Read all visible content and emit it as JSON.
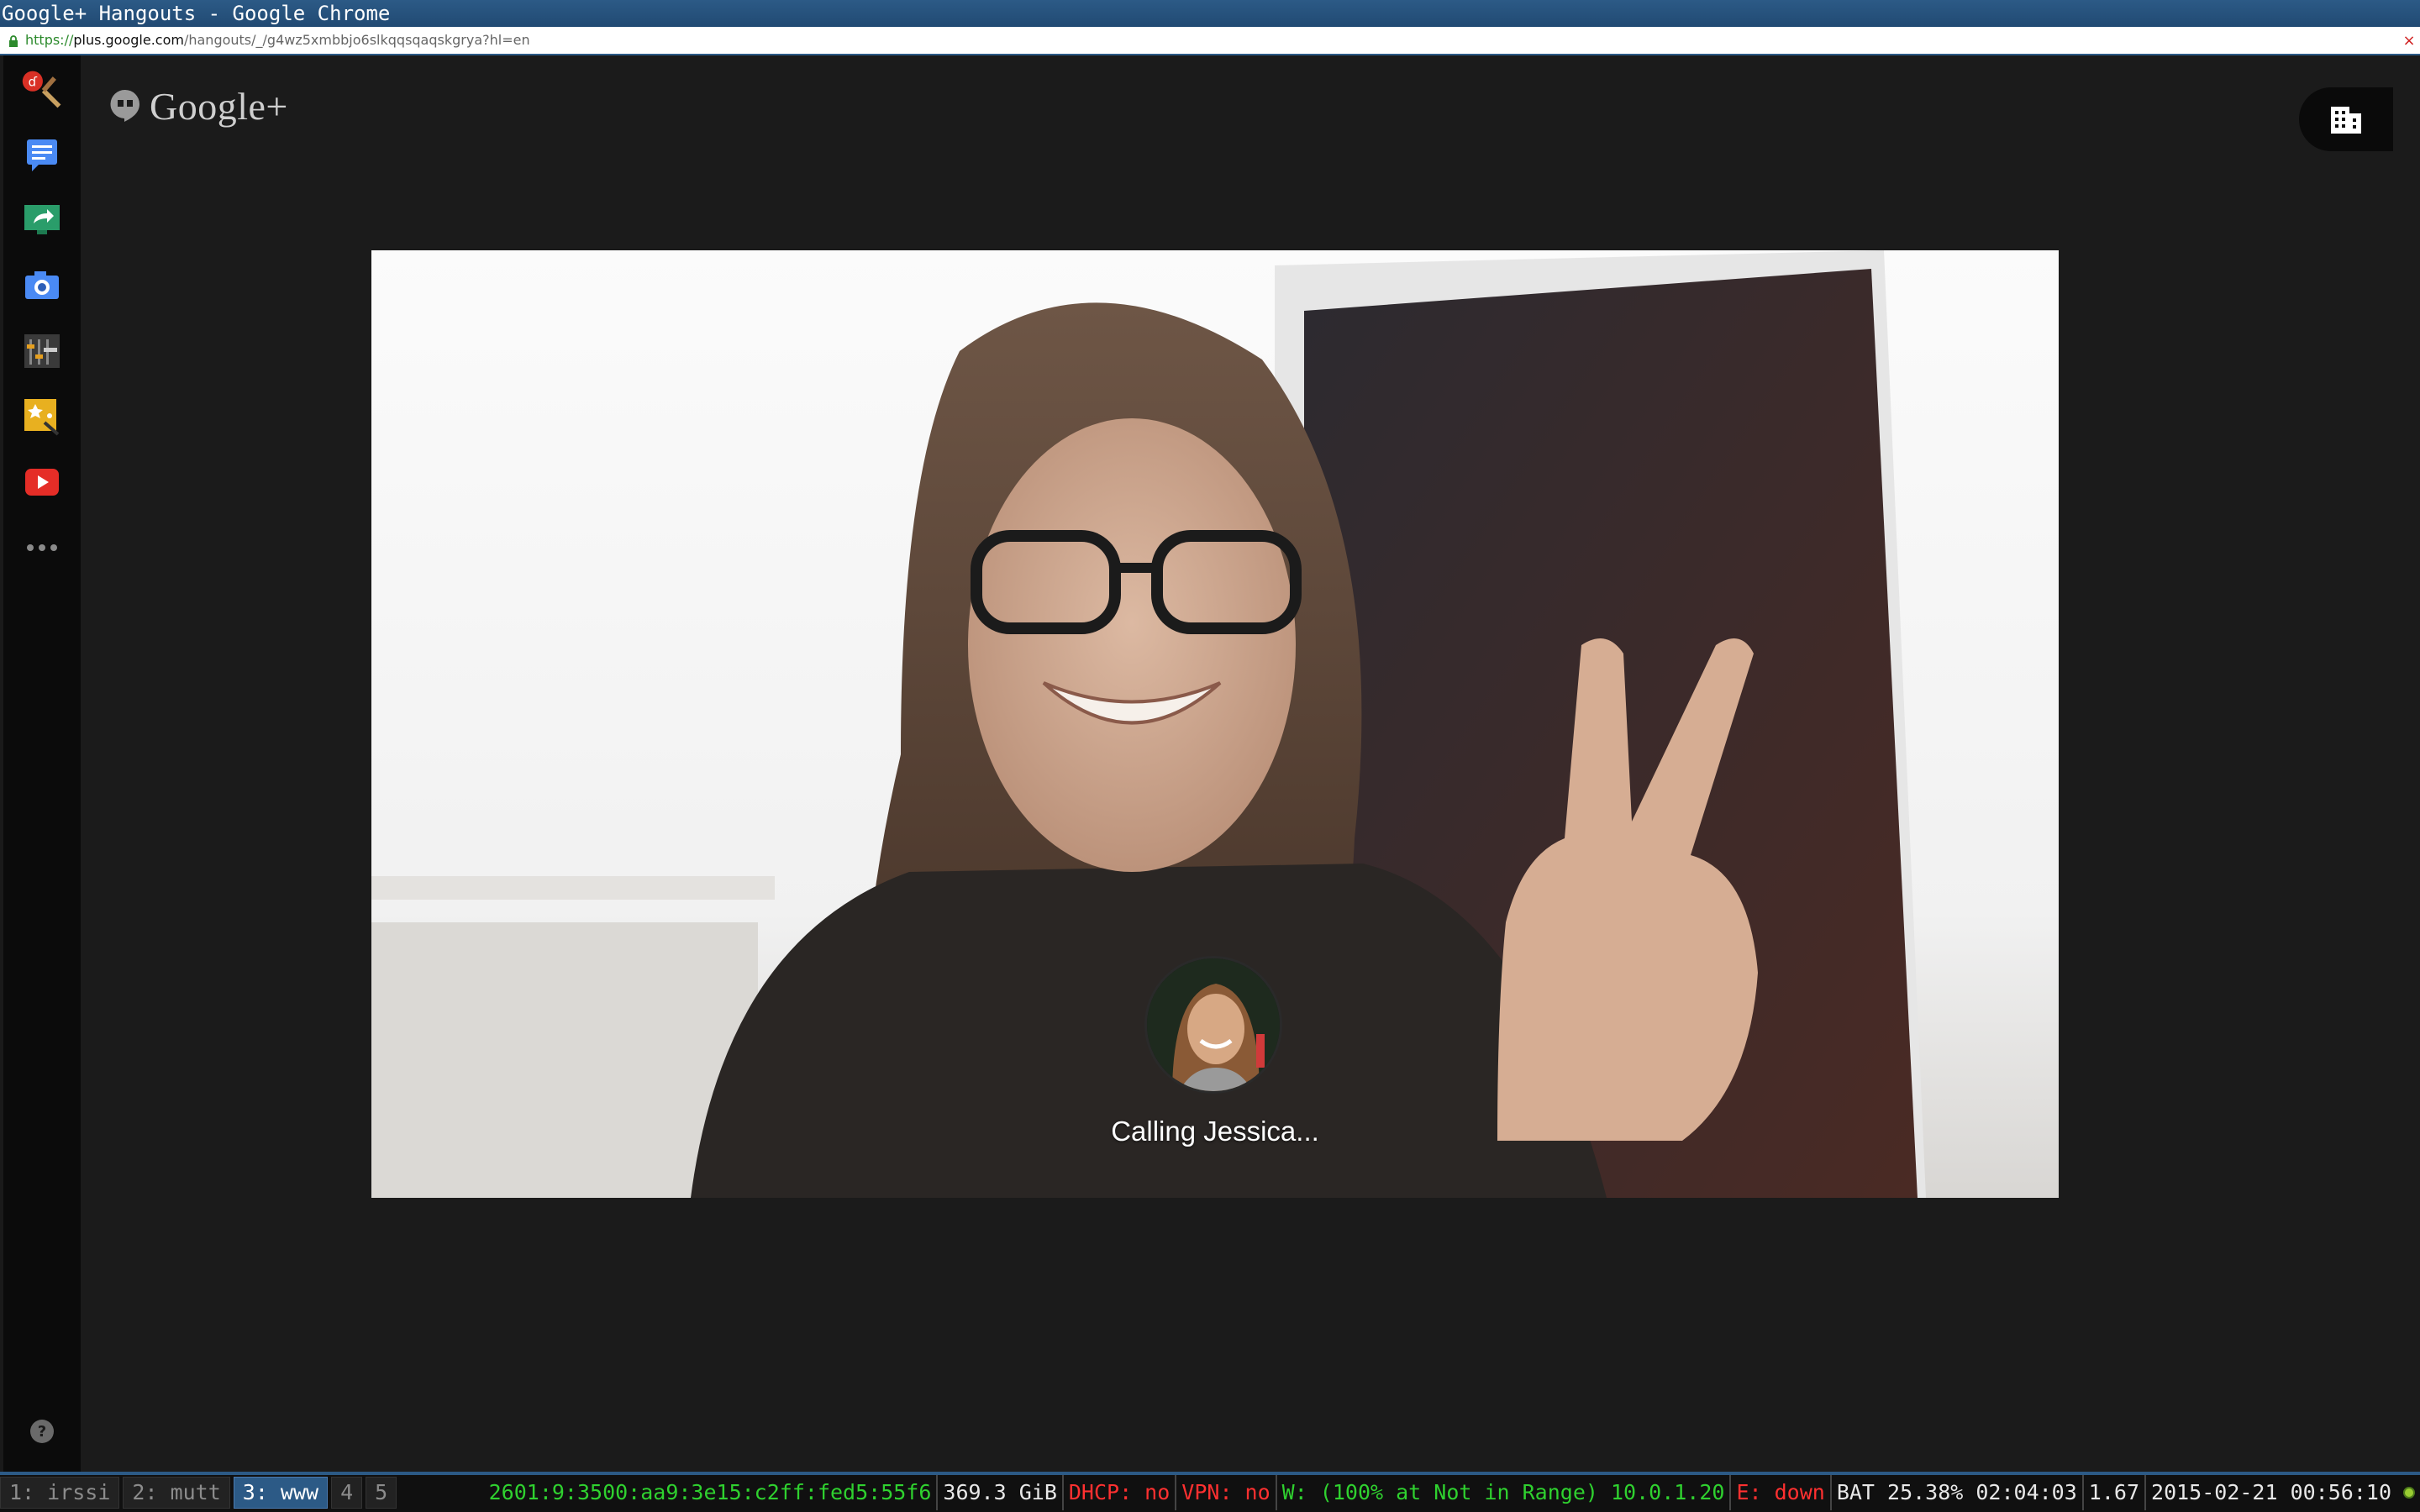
{
  "window": {
    "title": "Google+ Hangouts - Google Chrome"
  },
  "browser": {
    "url_scheme": "https://",
    "url_host": "plus.google.com",
    "url_path": "/hangouts/_/g4wz5xmbbjo6slkqqsqaqskgrya?hl=en",
    "close_glyph": "×"
  },
  "app": {
    "brand": "Google+",
    "rail_icons": [
      "hangouts-effects-icon",
      "chat-icon",
      "screenshare-icon",
      "camera-icon",
      "settings-sliders-icon",
      "effects-icon",
      "youtube-icon",
      "more-icon"
    ],
    "help_glyph": "?"
  },
  "call": {
    "status_text": "Calling Jessica..."
  },
  "statusbar": {
    "workspaces": [
      {
        "label": "1: irssi",
        "active": false
      },
      {
        "label": "2: mutt",
        "active": false
      },
      {
        "label": "3: www",
        "active": true
      },
      {
        "label": "4",
        "active": false
      },
      {
        "label": "5",
        "active": false
      }
    ],
    "ipv6": "2601:9:3500:aa9:3e15:c2ff:fed5:55f6",
    "disk": "369.3 GiB",
    "dhcp": "DHCP: no",
    "vpn": "VPN: no",
    "wifi": "W: (100% at Not in Range) 10.0.1.20",
    "ethernet": "E: down",
    "battery": "BAT 25.38% 02:04:03",
    "load": "1.67",
    "datetime": "2015-02-21 00:56:10"
  },
  "colors": {
    "titlebar": "#2c5a86",
    "status_green": "#2fd12f",
    "status_red": "#ff3030",
    "stage_bg": "#1b1b1b"
  }
}
